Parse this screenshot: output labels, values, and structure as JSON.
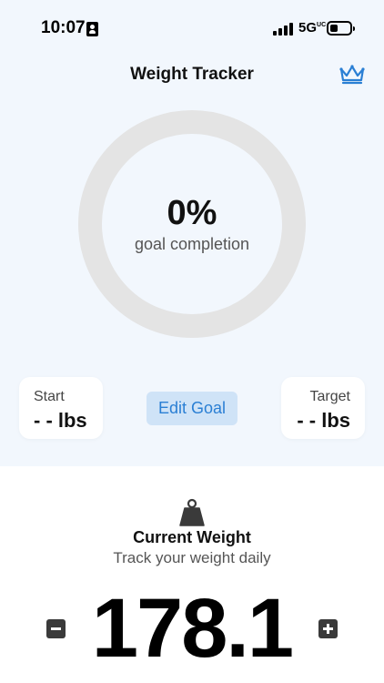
{
  "status_bar": {
    "time": "10:07",
    "network": "5G",
    "network_sup": "UC"
  },
  "header": {
    "title": "Weight Tracker",
    "premium_icon": "crown-icon"
  },
  "progress": {
    "percent_label": "0%",
    "caption": "goal completion",
    "fraction": 0
  },
  "cards": {
    "start": {
      "label": "Start",
      "value": "- - lbs"
    },
    "target": {
      "label": "Target",
      "value": "- - lbs"
    }
  },
  "edit_goal_label": "Edit Goal",
  "current": {
    "icon": "weight-icon",
    "title": "Current Weight",
    "subtitle": "Track your weight daily",
    "value": "178.1"
  },
  "colors": {
    "background_top": "#f2f7fd",
    "accent": "#2a7fd4",
    "ring_track": "#e4e4e4",
    "button_bg": "#cfe3f7"
  }
}
